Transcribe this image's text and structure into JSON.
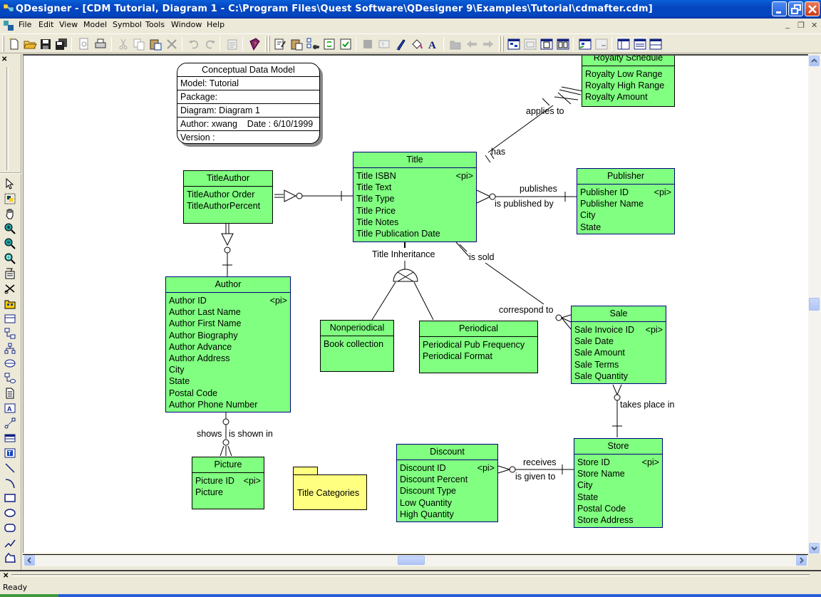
{
  "window": {
    "title": "QDesigner - [CDM Tutorial, Diagram 1 - C:\\Program Files\\Quest Software\\QDesigner 9\\Examples\\Tutorial\\cdmafter.cdm]",
    "controls": [
      "minimize",
      "restore",
      "close"
    ]
  },
  "menu": {
    "items": [
      "File",
      "Edit",
      "View",
      "Model",
      "Symbol",
      "Tools",
      "Window",
      "Help"
    ],
    "mdi_controls": [
      "_",
      "❐",
      "✕"
    ]
  },
  "toolbar": {
    "buttons": [
      "new-icon",
      "open-icon",
      "save-icon",
      "save-all-icon",
      "print-preview-icon",
      "print-icon",
      "cut-icon",
      "copy-icon",
      "paste-icon",
      "delete-icon",
      "undo-icon",
      "redo-icon",
      "properties-icon",
      "help-book-icon",
      "edit-icon",
      "paste-special-icon",
      "find-icon",
      "refresh-icon",
      "check-model-icon",
      "fill-icon",
      "text-frame-icon",
      "pen-icon",
      "paint-bucket-icon",
      "font-icon",
      "package-icon",
      "back-icon",
      "forward-icon",
      "diagram-icon",
      "layout-icon",
      "page-icon",
      "two-page-icon",
      "impact-icon",
      "generate-icon",
      "browser-icon",
      "output-icon",
      "result-list-icon"
    ]
  },
  "palette": {
    "tools": [
      "pointer-icon",
      "lasso-icon",
      "hand-icon",
      "zoom-in-icon",
      "zoom-out-icon",
      "zoom-fit-icon",
      "properties-icon",
      "delete-tool-icon",
      "package-tool-icon",
      "entity-tool-icon",
      "relationship-tool-icon",
      "inheritance-tool-icon",
      "association-tool-icon",
      "association-link-icon",
      "file-tool-icon",
      "title-tool-icon",
      "link-tool-icon",
      "table-tool-icon",
      "text-tool-icon",
      "line-tool-icon",
      "arc-tool-icon",
      "rectangle-tool-icon",
      "ellipse-tool-icon",
      "rounded-rect-tool-icon",
      "polyline-tool-icon",
      "polygon-tool-icon"
    ]
  },
  "model_info": {
    "header": "Conceptual Data Model",
    "model": "Model: Tutorial",
    "package": "Package:",
    "diagram": "Diagram: Diagram 1",
    "author_date": "Author: xwang    Date : 6/10/1999",
    "version": "Version :"
  },
  "entities": {
    "royalty": {
      "name": "Royalty Schedule",
      "attrs": [
        "Royalty Low Range",
        "Royalty High Range",
        "Royalty Amount"
      ]
    },
    "title": {
      "name": "Title",
      "attrs": [
        "Title ISBN",
        "Title Text",
        "Title Type",
        "Title Price",
        "Title Notes",
        "Title Publication Date"
      ],
      "pi": "<pi>"
    },
    "titleauthor": {
      "name": "TitleAuthor",
      "attrs": [
        "TitleAuthor Order",
        "TitleAuthorPercent"
      ]
    },
    "publisher": {
      "name": "Publisher",
      "attrs": [
        "Publisher ID",
        "Publisher Name",
        "City",
        "State"
      ],
      "pi": "<pi>"
    },
    "author": {
      "name": "Author",
      "attrs": [
        "Author ID",
        "Author Last Name",
        "Author First Name",
        "Author Biography",
        "Author Advance",
        "Author Address",
        "City",
        "State",
        "Postal Code",
        "Author Phone Number"
      ],
      "pi": "<pi>"
    },
    "nonperiodical": {
      "name": "Nonperiodical",
      "attrs": [
        "Book collection"
      ]
    },
    "periodical": {
      "name": "Periodical",
      "attrs": [
        "Periodical Pub Frequency",
        "Periodical Format"
      ]
    },
    "sale": {
      "name": "Sale",
      "attrs": [
        "Sale Invoice ID",
        "Sale Date",
        "Sale Amount",
        "Sale Terms",
        "Sale Quantity"
      ],
      "pi": "<pi>"
    },
    "picture": {
      "name": "Picture",
      "attrs": [
        "Picture ID",
        "Picture"
      ],
      "pi": "<pi>"
    },
    "discount": {
      "name": "Discount",
      "attrs": [
        "Discount ID",
        "Discount Percent",
        "Discount Type",
        "Low Quantity",
        "High Quantity"
      ],
      "pi": "<pi>"
    },
    "store": {
      "name": "Store",
      "attrs": [
        "Store ID",
        "Store Name",
        "City",
        "State",
        "Postal Code",
        "Store Address"
      ],
      "pi": "<pi>"
    }
  },
  "package": {
    "name": "Title Categories"
  },
  "relationship_labels": {
    "applies_to": "applies to",
    "has": "has",
    "publishes": "publishes",
    "is_published_by": "is published by",
    "title_inheritance": "Title Inheritance",
    "is_sold": "is sold",
    "correspond_to": "correspond to",
    "takes_place_in": "takes place in",
    "shows": "shows",
    "is_shown_in": "is shown in",
    "receives": "receives",
    "is_given_to": "is given to"
  },
  "colors": {
    "entity_fill": "#80ff80",
    "entity_border": "#000080",
    "package_fill": "#ffff80",
    "titlebar": "#0446c0"
  },
  "status": {
    "text": "Ready"
  }
}
